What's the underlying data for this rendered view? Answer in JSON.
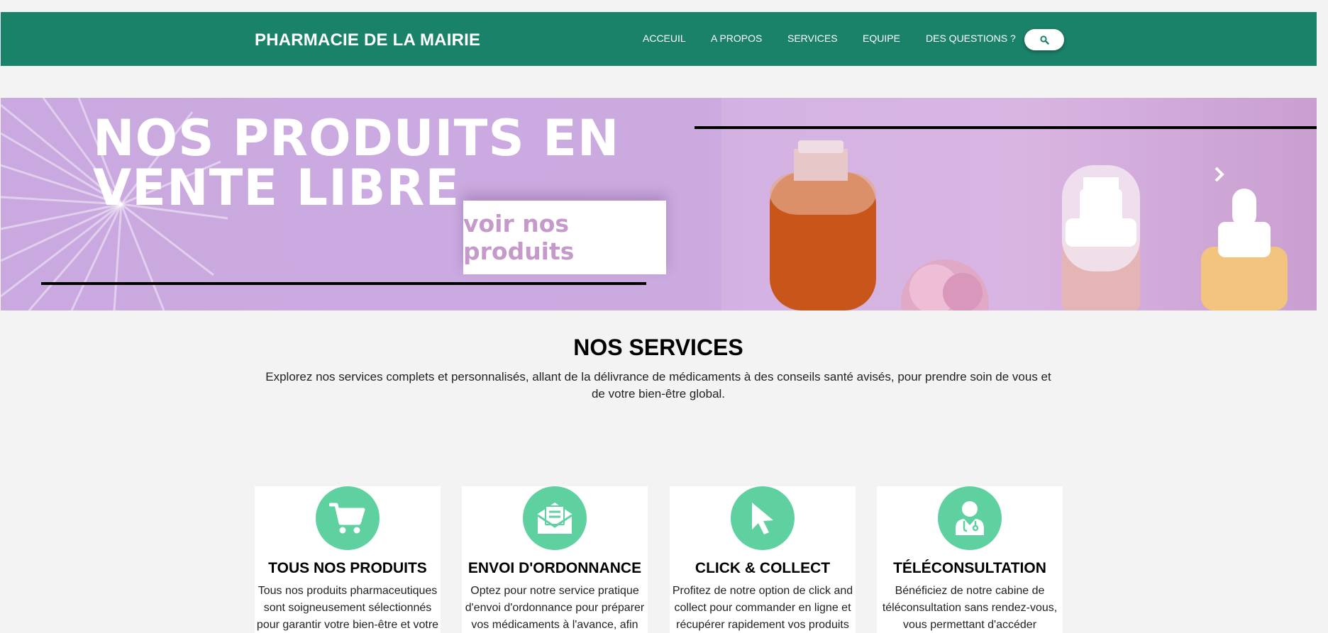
{
  "navbar": {
    "brand": "PHARMACIE DE LA MAIRIE",
    "links": [
      "ACCEUIL",
      "A PROPOS",
      "SERVICES",
      "EQUIPE",
      "DES QUESTIONS ?"
    ],
    "search_icon": "search-icon",
    "bg_color": "#1b826a"
  },
  "hero": {
    "title_line1": "NOS PRODUITS EN",
    "title_line2": "VENTE LIBRE",
    "cta_label": "voir nos produits",
    "next_icon": "chevron-right-icon",
    "bg_color": "#c9a9df"
  },
  "services": {
    "title": "NOS SERVICES",
    "description": "Explorez nos services complets et personnalisés, allant de la délivrance de médicaments à des conseils santé avisés, pour prendre soin de vous et de votre bien-être global.",
    "icon_color": "#5fd1a1",
    "cards": [
      {
        "icon": "shopping-cart-icon",
        "title": "TOUS NOS PRODUITS",
        "text": "Tous nos produits pharmaceutiques sont soigneusement sélectionnés pour garantir votre bien-être et votre"
      },
      {
        "icon": "envelope-document-icon",
        "title": "ENVOI D'ORDONNANCE",
        "text": "Optez pour notre service pratique d'envoi d'ordonnance pour préparer vos médicaments à l'avance, afin"
      },
      {
        "icon": "cursor-pointer-icon",
        "title": "CLICK & COLLECT",
        "text": "Profitez de notre option de click and collect pour commander en ligne et récupérer rapidement vos produits"
      },
      {
        "icon": "doctor-icon",
        "title": "TÉLÉCONSULTATION",
        "text": "Bénéficiez de notre cabine de téléconsultation sans rendez-vous, vous permettant d'accéder"
      }
    ]
  }
}
